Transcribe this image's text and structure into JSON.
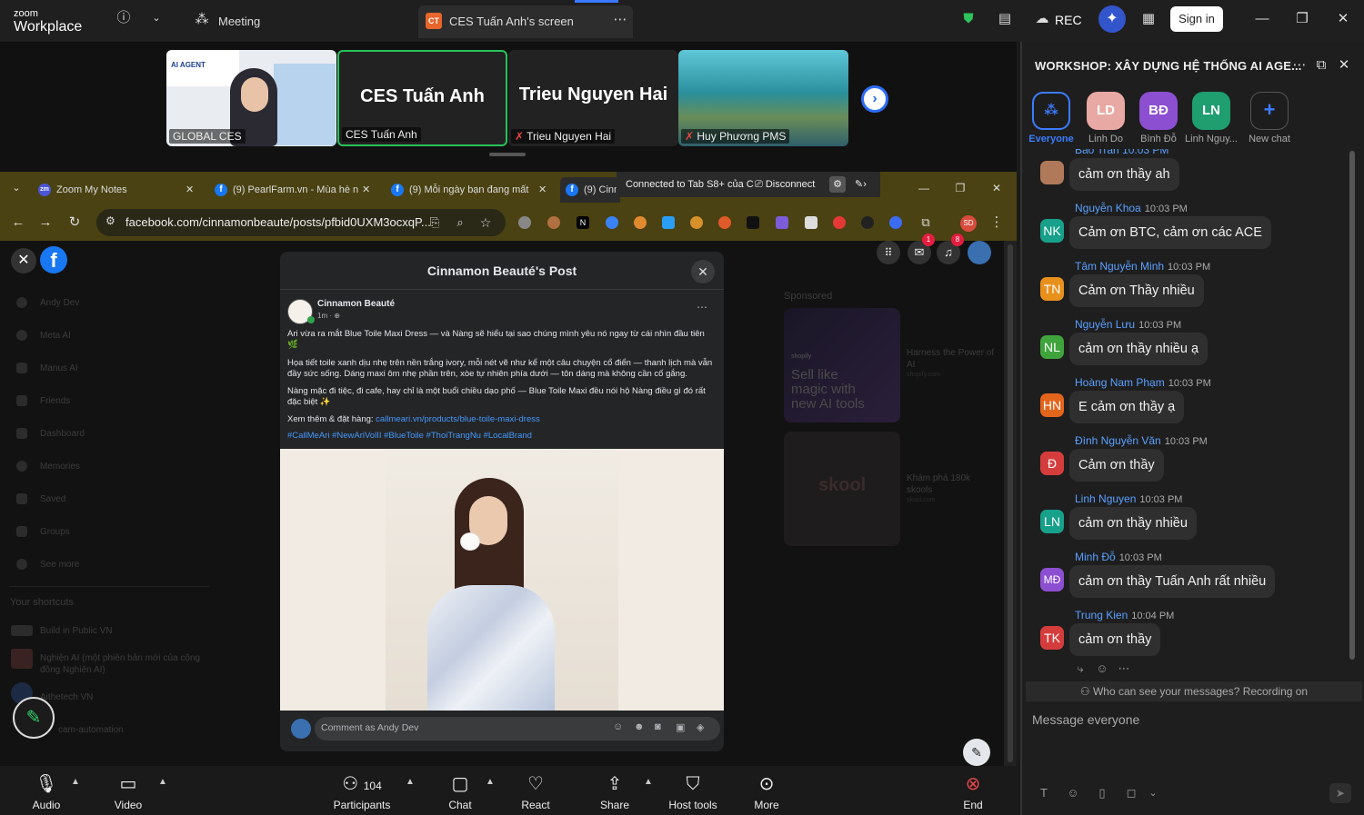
{
  "app": {
    "logo_small": "zoom",
    "logo_big": "Workplace"
  },
  "topbar": {
    "meeting_label": "Meeting",
    "screen_tab_badge": "CT",
    "screen_tab_label": "CES Tuấn Anh's screen",
    "rec_label": "REC",
    "signin_label": "Sign in"
  },
  "videos": [
    {
      "label": "GLOBAL CES",
      "kind": "camera"
    },
    {
      "big_name": "CES Tuấn Anh",
      "label": "CES Tuấn Anh"
    },
    {
      "big_name": "Trieu Nguyen Hai",
      "label": "Trieu Nguyen Hai",
      "muted": true
    },
    {
      "label": "Huy Phương PMS",
      "muted": true
    }
  ],
  "thumb_text": {
    "line1": "AI AGENT"
  },
  "browser": {
    "tabs": [
      {
        "label": "Zoom My Notes"
      },
      {
        "label": "(9) PearlFarm.vn - Mùa hè n"
      },
      {
        "label": "(9) Mỗi ngày bạn đang mất"
      },
      {
        "label": "(9) Cinn"
      }
    ],
    "share_connected": "Connected to Tab S8+ của C",
    "share_disconnect": "Disconnect",
    "url": "facebook.com/cinnamonbeaute/posts/pfbid0UXM3ocxqP...",
    "profile_badge": "SD"
  },
  "facebook": {
    "sidebar": [
      "Andy Dev",
      "Meta AI",
      "Manus AI",
      "Friends",
      "Dashboard",
      "Memories",
      "Saved",
      "Groups",
      "See more"
    ],
    "shortcuts_title": "Your shortcuts",
    "shortcuts": [
      "Build in Public VN",
      "Nghiện AI (một phiên bản mới của cộng",
      "đồng Nghiện AI)",
      "Aithetech VN",
      "cam-automation"
    ],
    "sponsored_title": "Sponsored",
    "ads": [
      {
        "title": "Harness the Power of",
        "title2": "AI",
        "domain": "shopify.com",
        "img_brand": "shopify",
        "img_text": [
          "Sell like",
          "magic with",
          "new AI tools"
        ]
      },
      {
        "title": "Khám phá 180k",
        "title2": "skools",
        "domain": "skool.com",
        "img_brand": "skool"
      }
    ],
    "notif_badges": {
      "messenger": "1",
      "bell": "8"
    },
    "modal": {
      "title": "Cinnamon Beauté's Post",
      "page_name": "Cinnamon Beauté",
      "meta": "1m · ",
      "p1": "Ari vừa ra mắt Blue Toile Maxi Dress — và Nàng sẽ hiểu tại sao chúng mình yêu nó ngay từ cái nhìn đầu tiên 🌿",
      "p2": "Họa tiết toile xanh dịu nhẹ trên nền trắng ivory, mỗi nét vẽ như kể một câu chuyện cổ điển — thanh lịch mà vẫn đầy sức sống. Dáng maxi ôm nhẹ phần trên, xòe tự nhiên phía dưới — tôn dáng mà không cần cố gắng.",
      "p3": "Nàng mặc đi tiệc, đi cafe, hay chỉ là một buổi chiều dạo phố — Blue Toile Maxi đều nói hộ Nàng điều gì đó rất đặc biệt ✨",
      "p4_prefix": "Xem thêm & đặt hàng: ",
      "p4_link": "callmeari.vn/products/blue-toile-maxi-dress",
      "hashtags": "#CallMeAri #NewAriVolII #BlueToile #ThoiTrangNu #LocalBrand",
      "comment_placeholder": "Comment as Andy Dev"
    }
  },
  "toolbar": {
    "audio": "Audio",
    "video": "Video",
    "participants": "Participants",
    "participants_count": "104",
    "chat": "Chat",
    "react": "React",
    "share": "Share",
    "host_tools": "Host tools",
    "more": "More",
    "end": "End"
  },
  "chat": {
    "title": "WORKSHOP: XÂY DỰNG HỆ THỐNG AI AGE...",
    "recipients": [
      {
        "initials": "",
        "name": "Everyone",
        "color": "#1d1d1d"
      },
      {
        "initials": "LD",
        "name": "Linh Do",
        "color": "#e8a9a4"
      },
      {
        "initials": "BĐ",
        "name": "Bình Đỗ",
        "color": "#8d4fd1"
      },
      {
        "initials": "LN",
        "name": "Linh Nguy...",
        "color": "#1f9e6f"
      },
      {
        "initials": "+",
        "name": "New chat",
        "color": "#1d1d1d"
      }
    ],
    "partial_name": "Bảo Trần 10:03 PM",
    "messages": [
      {
        "initials": "",
        "name": "",
        "time": "",
        "text": "cảm ơn thầy ah",
        "color": "#b07a5a"
      },
      {
        "initials": "NK",
        "name": "Nguyễn Khoa",
        "time": "10:03 PM",
        "text": "Cảm ơn BTC, cảm ơn các ACE",
        "color": "#17a08a"
      },
      {
        "initials": "TN",
        "name": "Tâm Nguyễn Minh",
        "time": "10:03 PM",
        "text": "Cảm ơn Thầy nhiều",
        "color": "#e8901c"
      },
      {
        "initials": "NL",
        "name": "Nguyễn Lưu",
        "time": "10:03 PM",
        "text": "cảm ơn thầy nhiều ạ",
        "color": "#3fa43c"
      },
      {
        "initials": "HN",
        "name": "Hoàng Nam Phạm",
        "time": "10:03 PM",
        "text": "E cảm ơn thầy ạ",
        "color": "#e2651c"
      },
      {
        "initials": "Đ",
        "name": "Đình Nguyễn Văn",
        "time": "10:03 PM",
        "text": "Cảm ơn thầy",
        "color": "#d53d3d"
      },
      {
        "initials": "LN",
        "name": "Linh Nguyen",
        "time": "10:03 PM",
        "text": "cảm ơn thầy nhiều",
        "color": "#17a08a"
      },
      {
        "initials": "MĐ",
        "name": "Minh Đỗ",
        "time": "10:03 PM",
        "text": "cảm ơn thầy Tuấn Anh rất nhiều",
        "color": "#8d4fd1"
      },
      {
        "initials": "TK",
        "name": "Trung Kien",
        "time": "10:04 PM",
        "text": "cảm ơn thầy",
        "color": "#d53d3d"
      }
    ],
    "who_can_see": "Who can see your messages? Recording on",
    "input_placeholder": "Message everyone"
  }
}
